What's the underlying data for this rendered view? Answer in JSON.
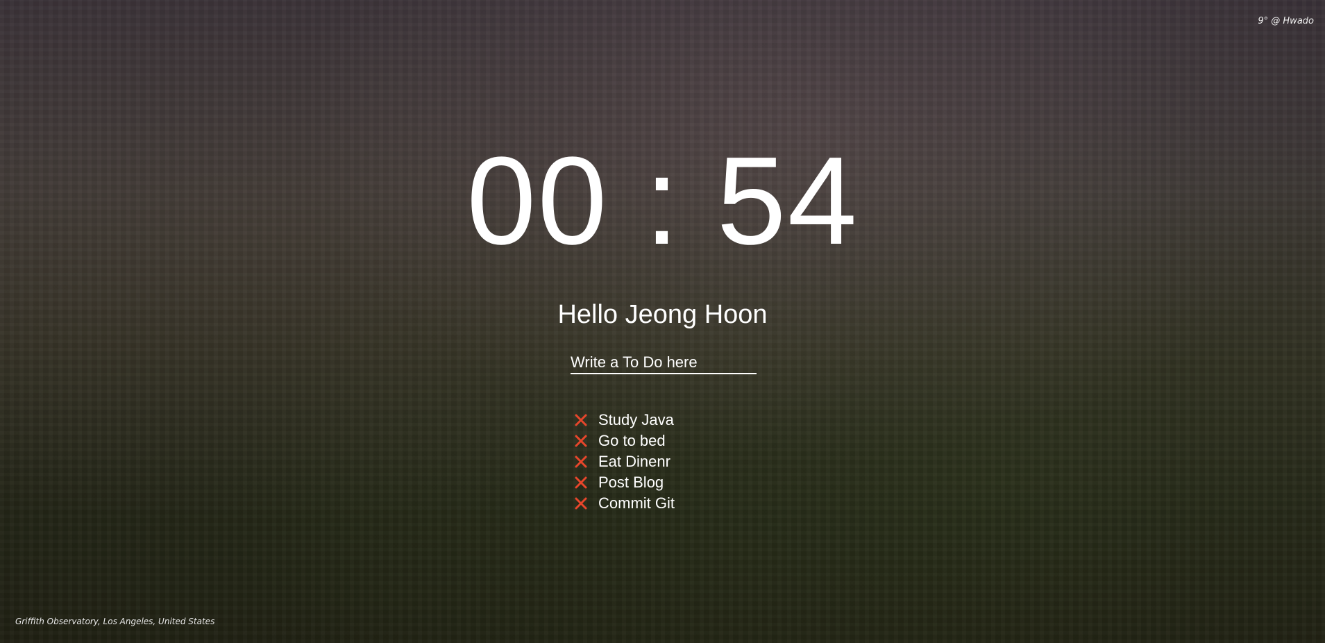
{
  "weather": {
    "text": "9° @ Hwado"
  },
  "clock": {
    "time": "00 : 54"
  },
  "greeting": {
    "text": "Hello Jeong Hoon"
  },
  "todo_form": {
    "placeholder": "Write a To Do here"
  },
  "todos": [
    {
      "text": "Study Java"
    },
    {
      "text": "Go to bed"
    },
    {
      "text": "Eat Dinenr"
    },
    {
      "text": "Post Blog"
    },
    {
      "text": "Commit Git"
    }
  ],
  "background": {
    "location": "Griffith Observatory, Los Angeles, United States"
  },
  "icons": {
    "delete": "close-x-icon"
  },
  "colors": {
    "delete_icon": "#e8462b",
    "text": "#ffffff"
  }
}
